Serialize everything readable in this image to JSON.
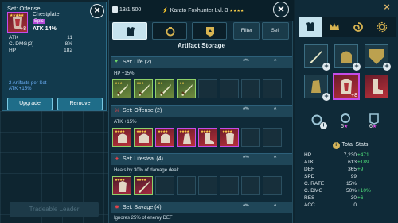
{
  "tooltip": {
    "title": "Set: Offense",
    "slot": "Chestplate",
    "rarity": "Epic",
    "level": "+8",
    "main_stat": "ATK 14%",
    "stats": [
      {
        "name": "ATK",
        "value": "11"
      },
      {
        "name": "C. DMG(2)",
        "value": "8%"
      },
      {
        "name": "HP",
        "value": "182"
      }
    ],
    "set_info_line1": "2 Artifacts per Set",
    "set_info_line2": "ATK +15%",
    "upgrade_label": "Upgrade",
    "remove_label": "Remove"
  },
  "background": {
    "button_label": "Tradeable Leader"
  },
  "storage": {
    "bag_count": "13/1,500",
    "hero_name": "Karato Foxhunter Lvl. 3",
    "filter_label": "Filter",
    "sell_label": "Sell",
    "title": "Artifact Storage",
    "sets": [
      {
        "name": "Set: Life (2)",
        "desc": "HP +15%"
      },
      {
        "name": "Set: Offense (2)",
        "desc": "ATK +15%"
      },
      {
        "name": "Set: Lifesteal (4)",
        "desc": "Heals by 30% of damage dealt"
      },
      {
        "name": "Set: Savage (4)",
        "desc": "Ignores 25% of enemy DEF"
      }
    ]
  },
  "gear": {
    "selected_level": "+8",
    "ring1_count": "5",
    "ring2_count": "6",
    "total_stats_title": "Total Stats",
    "stats": [
      {
        "name": "HP",
        "value": "7,230",
        "bonus": "+471"
      },
      {
        "name": "ATK",
        "value": "613",
        "bonus": "+189"
      },
      {
        "name": "DEF",
        "value": "365",
        "bonus": "+9"
      },
      {
        "name": "SPD",
        "value": "99",
        "bonus": ""
      },
      {
        "name": "C. RATE",
        "value": "15%",
        "bonus": ""
      },
      {
        "name": "C. DMG",
        "value": "50%",
        "bonus": "+10%"
      },
      {
        "name": "RES",
        "value": "30",
        "bonus": "+6"
      },
      {
        "name": "ACC",
        "value": "0",
        "bonus": ""
      }
    ]
  },
  "colors": {
    "epic": "#c44ce8",
    "uncommon": "#8fd16a",
    "bonus_green": "#4fe07c",
    "panel": "#0f2a38"
  }
}
